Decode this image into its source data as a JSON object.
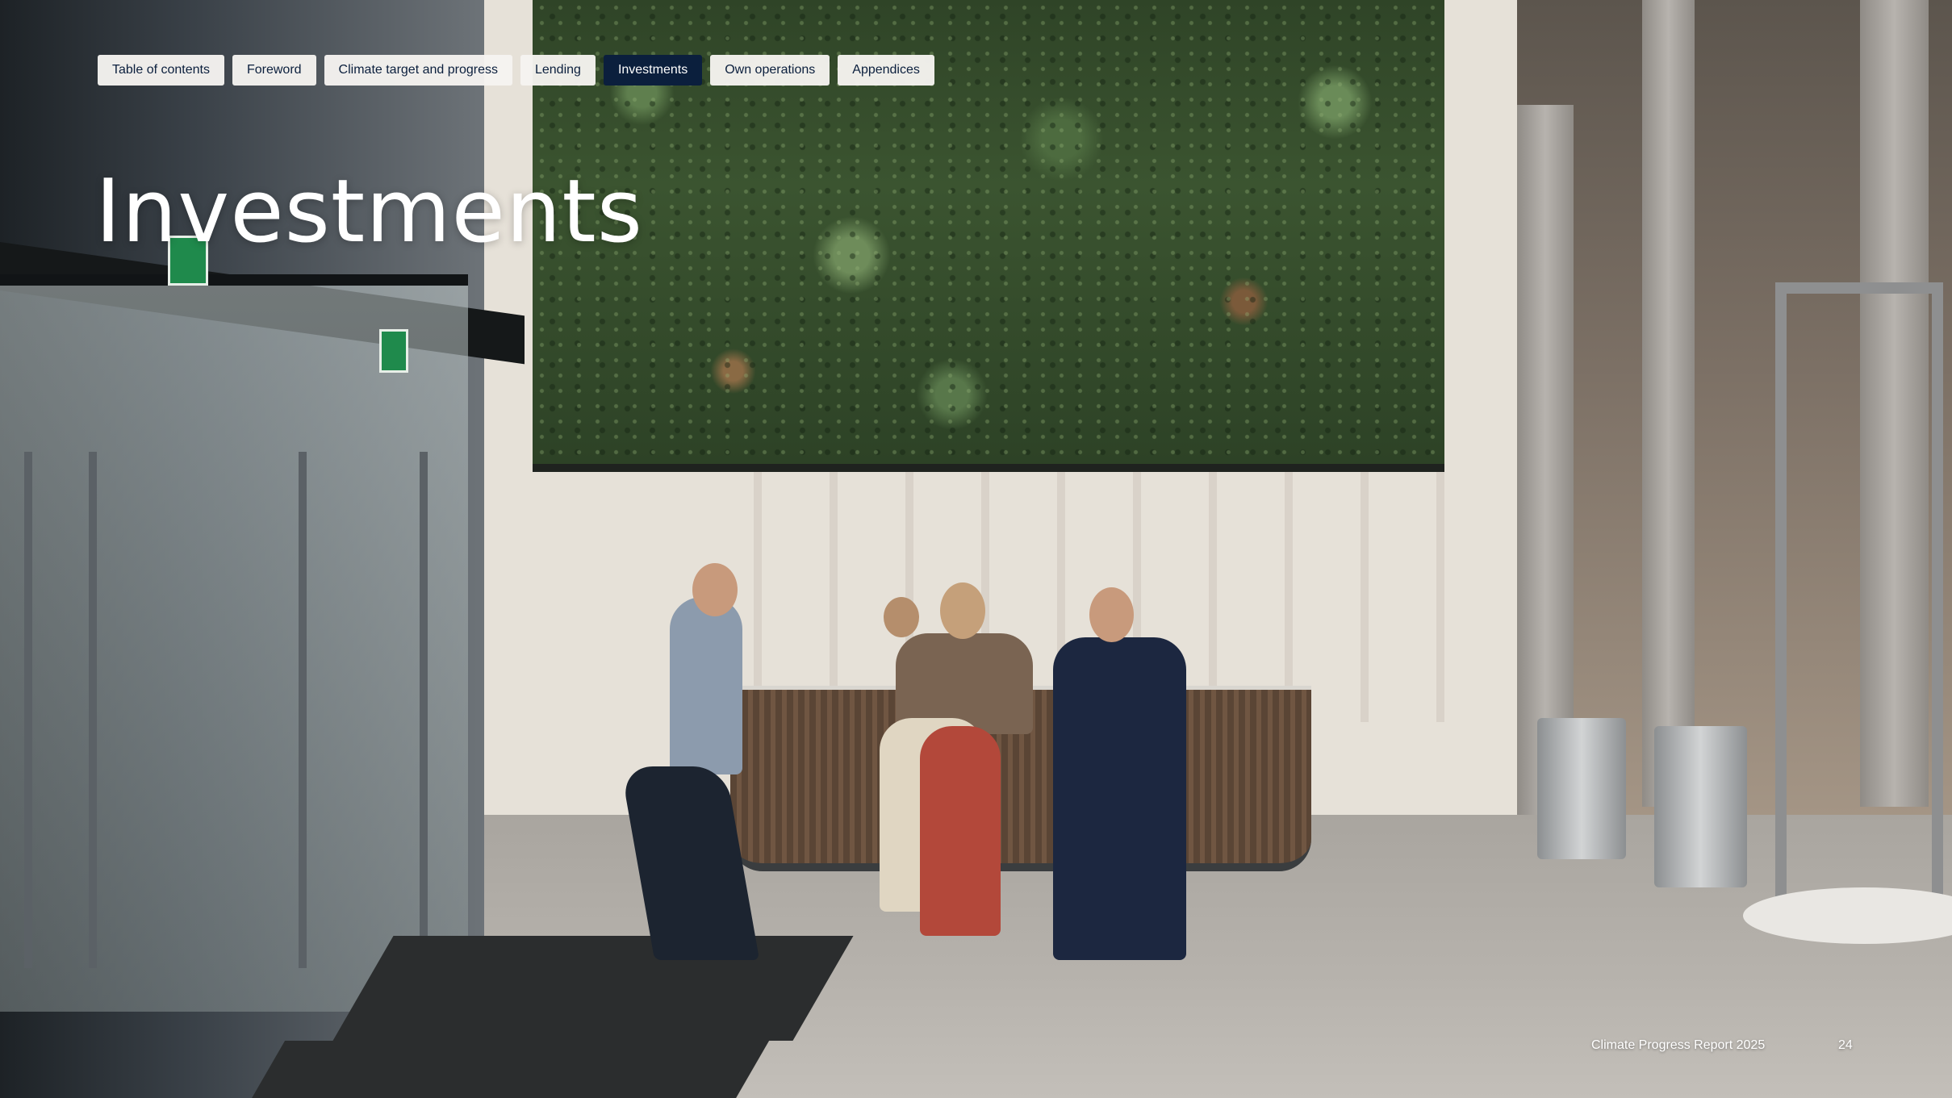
{
  "nav": {
    "tabs": [
      {
        "label": "Table of contents",
        "active": false
      },
      {
        "label": "Foreword",
        "active": false
      },
      {
        "label": "Climate target and progress",
        "active": false
      },
      {
        "label": "Lending",
        "active": false
      },
      {
        "label": "Investments",
        "active": true
      },
      {
        "label": "Own operations",
        "active": false
      },
      {
        "label": "Appendices",
        "active": false
      }
    ],
    "active_color": "#0b1f3d",
    "inactive_color": "#f6f4f0"
  },
  "page": {
    "title": "Investments"
  },
  "footer": {
    "report_name": "Climate Progress Report 2025",
    "page_number": "24"
  }
}
